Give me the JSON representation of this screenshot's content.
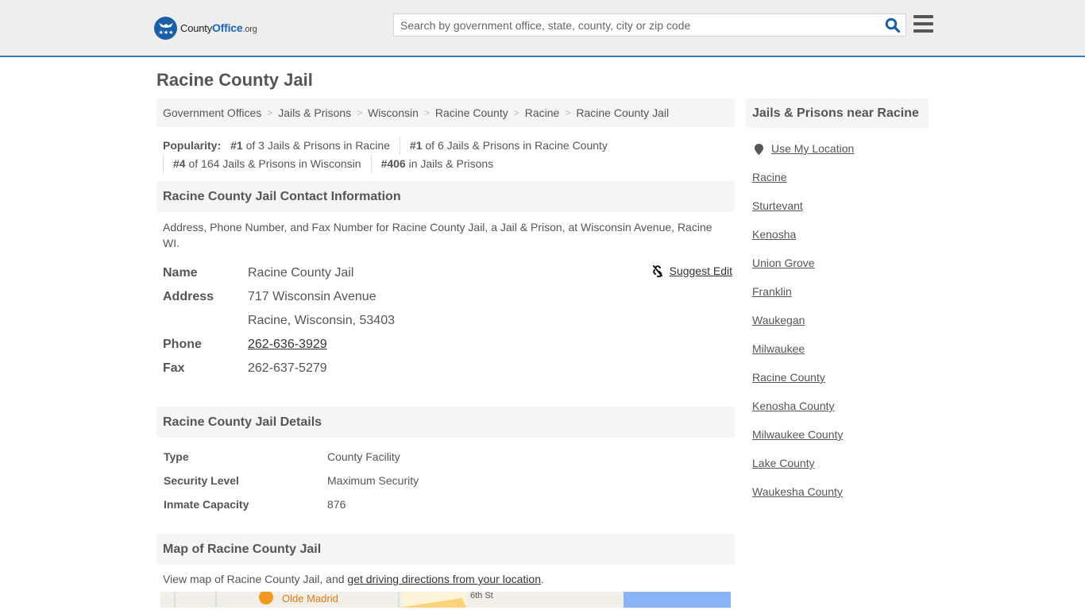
{
  "header": {
    "logo": {
      "part1": "County",
      "part2": "Office",
      "part3": ".org"
    },
    "search_placeholder": "Search by government office, state, county, city or zip code",
    "search_value": "",
    "brand_color": "#337ab7"
  },
  "page_title": "Racine County Jail",
  "breadcrumb": [
    "Government Offices",
    "Jails & Prisons",
    "Wisconsin",
    "Racine County",
    "Racine",
    "Racine County Jail"
  ],
  "popularity": {
    "label": "Popularity:",
    "items": [
      {
        "rank": "#1",
        "text": " of 3 Jails & Prisons in Racine"
      },
      {
        "rank": "#1",
        "text": " of 6 Jails & Prisons in Racine County"
      },
      {
        "rank": "#4",
        "text": " of 164 Jails & Prisons in Wisconsin"
      },
      {
        "rank": "#406",
        "text": " in Jails & Prisons"
      }
    ]
  },
  "contact": {
    "heading": "Racine County Jail Contact Information",
    "description": "Address, Phone Number, and Fax Number for Racine County Jail, a Jail & Prison, at Wisconsin Avenue, Racine WI.",
    "suggest_edit": "Suggest Edit",
    "labels": {
      "name": "Name",
      "address": "Address",
      "phone": "Phone",
      "fax": "Fax"
    },
    "name": "Racine County Jail",
    "address_line1": "717 Wisconsin Avenue",
    "address_line2": "Racine, Wisconsin, 53403",
    "phone": "262-636-3929",
    "fax": "262-637-5279"
  },
  "details": {
    "heading": "Racine County Jail Details",
    "rows": [
      {
        "label": "Type",
        "value": "County Facility"
      },
      {
        "label": "Security Level",
        "value": "Maximum Security"
      },
      {
        "label": "Inmate Capacity",
        "value": "876"
      }
    ]
  },
  "map": {
    "heading": "Map of Racine County Jail",
    "text_before": "View map of Racine County Jail, and ",
    "link": "get driving directions from your location",
    "text_after": ".",
    "labels": {
      "place": "Olde Madrid",
      "street": "6th St"
    }
  },
  "sidebar": {
    "heading": "Jails & Prisons near Racine",
    "use_location": "Use My Location",
    "links": [
      "Racine",
      "Sturtevant",
      "Kenosha",
      "Union Grove",
      "Franklin",
      "Waukegan",
      "Milwaukee",
      "Racine County",
      "Kenosha County",
      "Milwaukee County",
      "Lake County",
      "Waukesha County"
    ]
  }
}
